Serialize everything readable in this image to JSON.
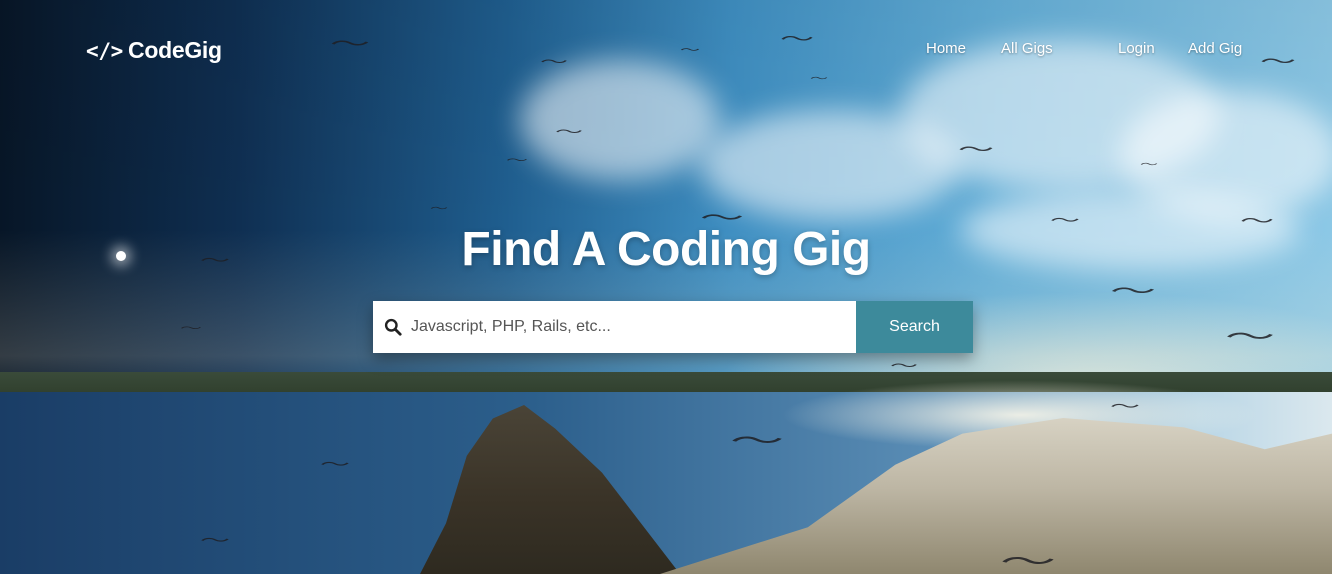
{
  "navbar": {
    "brand": {
      "icon": "code-icon",
      "icon_glyph": "</>",
      "name": "CodeGig"
    },
    "links": [
      {
        "label": "Home"
      },
      {
        "label": "All Gigs"
      },
      {
        "label": "Login"
      },
      {
        "label": "Add Gig"
      }
    ]
  },
  "hero": {
    "headline": "Find A Coding Gig"
  },
  "search": {
    "icon": "search-icon",
    "placeholder": "Javascript, PHP, Rails, etc...",
    "value": "",
    "button_label": "Search",
    "button_color": "#3d8a9b"
  }
}
